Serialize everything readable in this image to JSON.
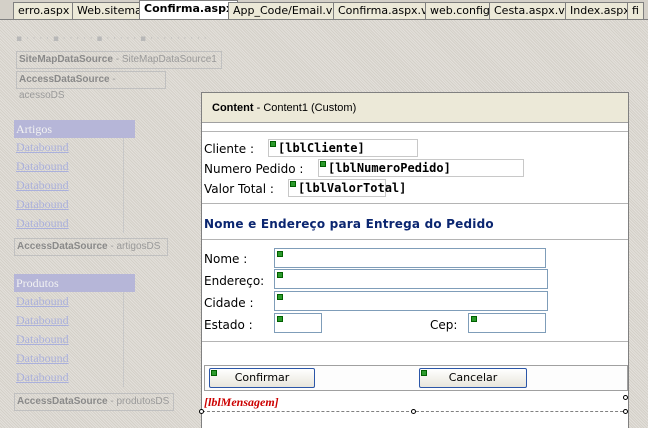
{
  "tabs": [
    {
      "label": "erro.aspx",
      "active": false
    },
    {
      "label": "Web.sitemap",
      "active": false
    },
    {
      "label": "Confirma.aspx",
      "active": true
    },
    {
      "label": "App_Code/Email.vb",
      "active": false
    },
    {
      "label": "Confirma.aspx.vb",
      "active": false
    },
    {
      "label": "web.config",
      "active": false
    },
    {
      "label": "Cesta.aspx.vb",
      "active": false
    },
    {
      "label": "Index.aspx",
      "active": false
    },
    {
      "label": "fi",
      "active": false
    }
  ],
  "master": {
    "sitemap_datasource": {
      "type": "SiteMapDataSource",
      "id": "SiteMapDataSource1"
    },
    "acesso_datasource": {
      "type": "AccessDataSource",
      "id": "acessoDS"
    },
    "artigos_datasource": {
      "type": "AccessDataSource",
      "id": "artigosDS"
    },
    "produtos_datasource": {
      "type": "AccessDataSource",
      "id": "produtosDS"
    },
    "menu1": {
      "header": "Artigos",
      "items": [
        "Databound",
        "Databound",
        "Databound",
        "Databound",
        "Databound"
      ]
    },
    "menu2": {
      "header": "Produtos",
      "items": [
        "Databound",
        "Databound",
        "Databound",
        "Databound",
        "Databound"
      ]
    }
  },
  "content": {
    "header_bold": "Content",
    "header_rest": " - Content1 (Custom)",
    "cliente_label": "Cliente :",
    "cliente_value": "[lblCliente]",
    "numero_label": "Numero Pedido :",
    "numero_value": "[lblNumeroPedido]",
    "valor_label": "Valor Total :",
    "valor_value": "[lblValorTotal]",
    "section_title": "Nome  e Endereço para Entrega do Pedido",
    "nome_label": "Nome    :",
    "endereco_label": "Endereço:",
    "cidade_label": "Cidade   :",
    "estado_label": "Estado   :",
    "cep_label": "Cep:",
    "confirmar_button": "Confirmar",
    "cancelar_button": "Cancelar",
    "mensagem_label": "[lblMensagem]"
  },
  "colors": {
    "section_title": "#0b2670",
    "mensagem": "#cc0000",
    "smart_tag": "#2c9a2c"
  }
}
